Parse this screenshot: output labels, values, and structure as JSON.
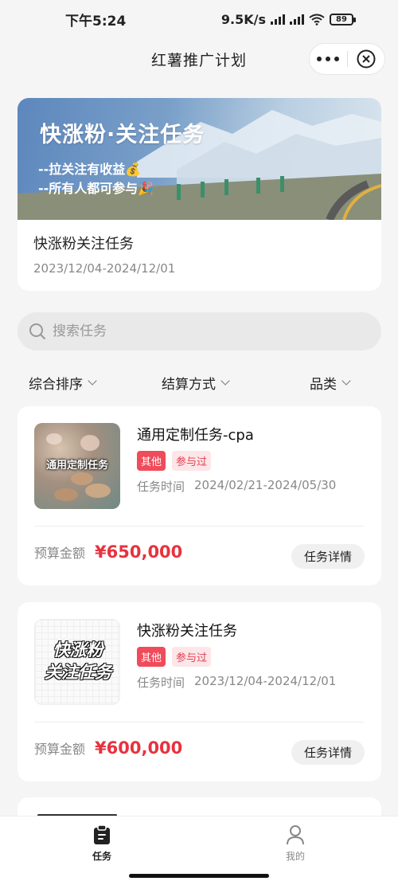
{
  "status_bar": {
    "time": "下午5:24",
    "network_speed": "9.5K/s",
    "battery": "89"
  },
  "nav": {
    "title": "红薯推广计划",
    "more_icon": "more-dots-icon",
    "close_icon": "close-circle-icon"
  },
  "banner": {
    "heading": "快涨粉·关注任务",
    "line1": "--拉关注有收益💰",
    "line2": "--所有人都可参与🎉",
    "name": "快涨粉关注任务",
    "date_range": "2023/12/04-2024/12/01"
  },
  "search": {
    "placeholder": "搜索任务"
  },
  "filters": [
    {
      "label": "综合排序"
    },
    {
      "label": "结算方式"
    },
    {
      "label": "品类"
    }
  ],
  "tasks": [
    {
      "thumb_text": "通用定制任务",
      "title": "通用定制任务-cpa",
      "tags": [
        "其他",
        "参与过"
      ],
      "time_label": "任务时间",
      "time_range": "2024/02/21-2024/05/30",
      "budget_label": "预算金额",
      "budget_value": "¥650,000",
      "detail_label": "任务详情"
    },
    {
      "thumb_text_line1": "快涨粉",
      "thumb_text_line2": "关注任务",
      "title": "快涨粉关注任务",
      "tags": [
        "其他",
        "参与过"
      ],
      "time_label": "任务时间",
      "time_range": "2023/12/04-2024/12/01",
      "budget_label": "预算金额",
      "budget_value": "¥600,000",
      "detail_label": "任务详情"
    }
  ],
  "tabbar": {
    "tasks_label": "任务",
    "me_label": "我的"
  },
  "colors": {
    "accent_red": "#e8323f",
    "tag_red": "#f04b5a",
    "background": "#f5f5f5"
  }
}
